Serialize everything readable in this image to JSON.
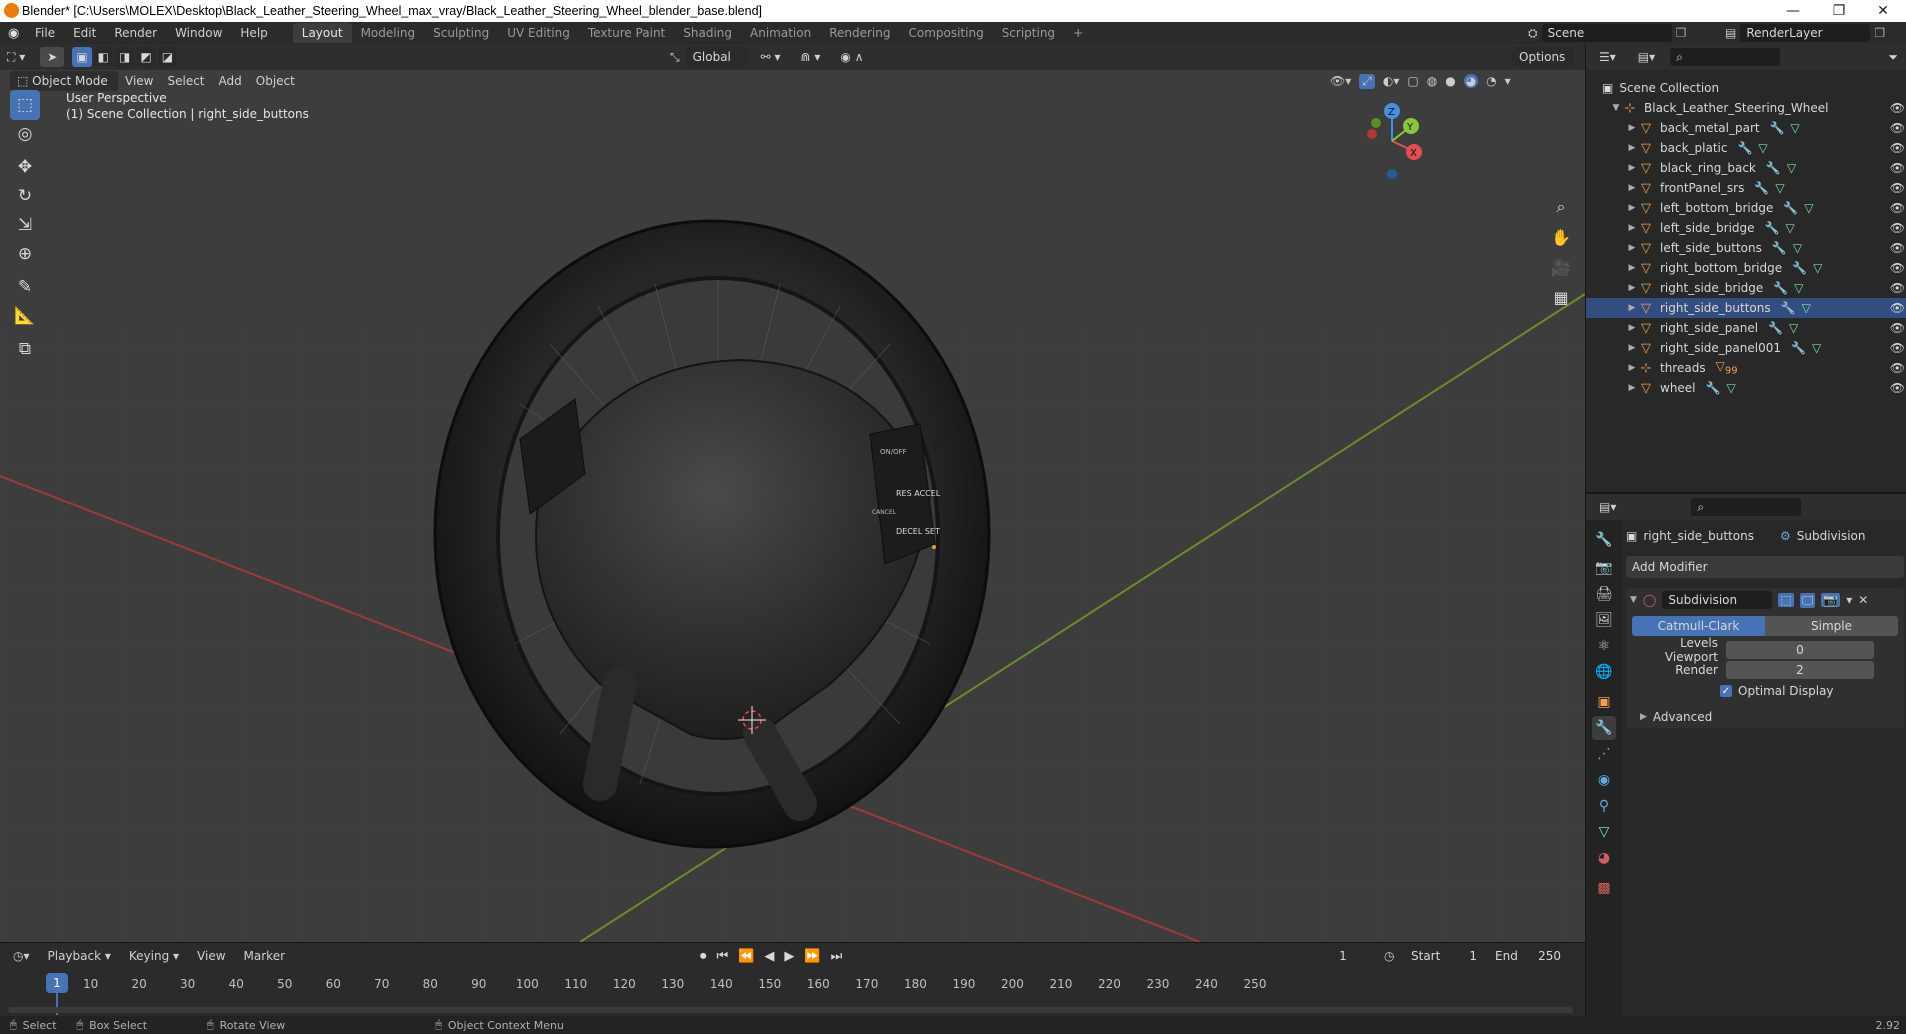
{
  "window": {
    "title": "Blender* [C:\\Users\\MOLEX\\Desktop\\Black_Leather_Steering_Wheel_max_vray/Black_Leather_Steering_Wheel_blender_base.blend]",
    "minimize": "—",
    "maximize": "❐",
    "close": "✕"
  },
  "menubar": {
    "menus": [
      "File",
      "Edit",
      "Render",
      "Window",
      "Help"
    ],
    "workspaces": [
      "Layout",
      "Modeling",
      "Sculpting",
      "UV Editing",
      "Texture Paint",
      "Shading",
      "Animation",
      "Rendering",
      "Compositing",
      "Scripting"
    ],
    "active_workspace": "Layout",
    "add_tab": "+",
    "scene": "Scene",
    "render_layer": "RenderLayer"
  },
  "viewport": {
    "transform_orientation": "Global",
    "options_label": "Options",
    "mode": "Object Mode",
    "header_menus": [
      "View",
      "Select",
      "Add",
      "Object"
    ],
    "overlay_line1": "User Perspective",
    "overlay_line2": "(1) Scene Collection | right_side_buttons",
    "gizmo": {
      "x": "X",
      "y": "Y",
      "z": "Z"
    },
    "button_labels": [
      "ON/OFF",
      "RES ACCEL",
      "CANCEL",
      "DECEL SET"
    ]
  },
  "outliner": {
    "root": "Scene Collection",
    "collection": "Black_Leather_Steering_Wheel",
    "objects": [
      {
        "name": "back_metal_part",
        "selected": false
      },
      {
        "name": "back_platic",
        "selected": false
      },
      {
        "name": "black_ring_back",
        "selected": false
      },
      {
        "name": "frontPanel_srs",
        "selected": false
      },
      {
        "name": "left_bottom_bridge",
        "selected": false
      },
      {
        "name": "left_side_bridge",
        "selected": false
      },
      {
        "name": "left_side_buttons",
        "selected": false
      },
      {
        "name": "right_bottom_bridge",
        "selected": false
      },
      {
        "name": "right_side_bridge",
        "selected": false
      },
      {
        "name": "right_side_buttons",
        "selected": true
      },
      {
        "name": "right_side_panel",
        "selected": false
      },
      {
        "name": "right_side_panel001",
        "selected": false
      },
      {
        "name": "threads",
        "selected": false,
        "badge": "99"
      },
      {
        "name": "wheel",
        "selected": false
      }
    ]
  },
  "properties": {
    "object_name": "right_side_buttons",
    "modifier_context": "Subdivision",
    "add_modifier": "Add Modifier",
    "modifier_name": "Subdivision",
    "algo_options": [
      "Catmull-Clark",
      "Simple"
    ],
    "active_algo": "Catmull-Clark",
    "levels_viewport_label": "Levels Viewport",
    "levels_viewport": "0",
    "render_label": "Render",
    "render_value": "2",
    "optimal_display_label": "Optimal Display",
    "optimal_display": true,
    "advanced_label": "Advanced"
  },
  "timeline": {
    "menus": [
      "Playback",
      "Keying",
      "View",
      "Marker"
    ],
    "current_frame": "1",
    "start_label": "Start",
    "start_value": "1",
    "end_label": "End",
    "end_value": "250",
    "ticks": [
      "1",
      "10",
      "20",
      "30",
      "40",
      "50",
      "60",
      "70",
      "80",
      "90",
      "100",
      "110",
      "120",
      "130",
      "140",
      "150",
      "160",
      "170",
      "180",
      "190",
      "200",
      "210",
      "220",
      "230",
      "240",
      "250"
    ]
  },
  "statusbar": {
    "select": "Select",
    "box_select": "Box Select",
    "rotate_view": "Rotate View",
    "context_menu": "Object Context Menu",
    "version": "2.92"
  },
  "colors": {
    "accent": "#4772b3",
    "selected_row": "#334d80",
    "viewport_bg": "#3d3d3d",
    "panel_bg": "#282828",
    "x_axis": "#e05050",
    "y_axis": "#8cc43c",
    "z_axis": "#4a8ee0"
  }
}
